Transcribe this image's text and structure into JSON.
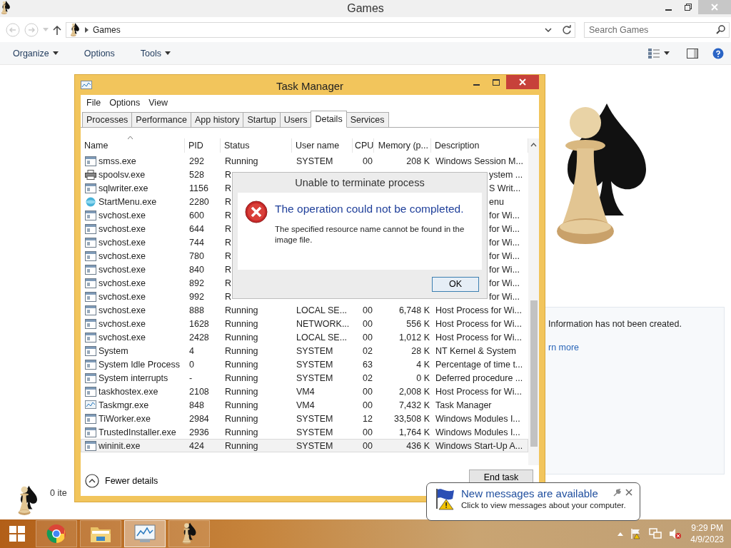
{
  "explorer": {
    "title": "Games",
    "breadcrumb": "Games",
    "search": {
      "placeholder": "Search Games"
    },
    "toolbar": [
      {
        "label": "Organize",
        "dropdown": true
      },
      {
        "label": "Options",
        "dropdown": false
      },
      {
        "label": "Tools",
        "dropdown": true
      }
    ],
    "info": {
      "text": "Information has not been created.",
      "link": "rn more"
    },
    "status": "0 ite"
  },
  "task_manager": {
    "title": "Task Manager",
    "menu": [
      "File",
      "Options",
      "View"
    ],
    "tabs": [
      {
        "label": "Processes",
        "selected": false
      },
      {
        "label": "Performance",
        "selected": false
      },
      {
        "label": "App history",
        "selected": false
      },
      {
        "label": "Startup",
        "selected": false
      },
      {
        "label": "Users",
        "selected": false
      },
      {
        "label": "Details",
        "selected": true
      },
      {
        "label": "Services",
        "selected": false
      }
    ],
    "columns": [
      "Name",
      "PID",
      "Status",
      "User name",
      "CPU",
      "Memory (p...",
      "Description"
    ],
    "rows": [
      {
        "kind": "window",
        "name": "smss.exe",
        "pid": "292",
        "status": "Running",
        "user": "SYSTEM",
        "cpu": "00",
        "memory": "208 K",
        "description": "Windows Session M...",
        "selected": false
      },
      {
        "kind": "printer",
        "name": "spoolsv.exe",
        "pid": "528",
        "status": "R",
        "description": "ystem ...",
        "selected": false
      },
      {
        "kind": "window",
        "name": "sqlwriter.exe",
        "pid": "1156",
        "status": "R",
        "description": "S Writ...",
        "selected": false
      },
      {
        "kind": "globe",
        "name": "StartMenu.exe",
        "pid": "2280",
        "status": "R",
        "description": "enu",
        "selected": false
      },
      {
        "kind": "window",
        "name": "svchost.exe",
        "pid": "600",
        "status": "R",
        "description": "for Wi...",
        "selected": false
      },
      {
        "kind": "window",
        "name": "svchost.exe",
        "pid": "644",
        "status": "R",
        "description": "for Wi...",
        "selected": false
      },
      {
        "kind": "window",
        "name": "svchost.exe",
        "pid": "744",
        "status": "R",
        "description": "for Wi...",
        "selected": false
      },
      {
        "kind": "window",
        "name": "svchost.exe",
        "pid": "780",
        "status": "R",
        "description": "for Wi...",
        "selected": false
      },
      {
        "kind": "window",
        "name": "svchost.exe",
        "pid": "840",
        "status": "R",
        "description": "for Wi...",
        "selected": false
      },
      {
        "kind": "window",
        "name": "svchost.exe",
        "pid": "892",
        "status": "R",
        "description": "for Wi...",
        "selected": false
      },
      {
        "kind": "window",
        "name": "svchost.exe",
        "pid": "992",
        "status": "R",
        "description": "for Wi...",
        "selected": false
      },
      {
        "kind": "window",
        "name": "svchost.exe",
        "pid": "888",
        "status": "Running",
        "user": "LOCAL SE...",
        "cpu": "00",
        "memory": "6,748 K",
        "description": "Host Process for Wi...",
        "selected": false
      },
      {
        "kind": "window",
        "name": "svchost.exe",
        "pid": "1628",
        "status": "Running",
        "user": "NETWORK...",
        "cpu": "00",
        "memory": "556 K",
        "description": "Host Process for Wi...",
        "selected": false
      },
      {
        "kind": "window",
        "name": "svchost.exe",
        "pid": "2428",
        "status": "Running",
        "user": "LOCAL SE...",
        "cpu": "00",
        "memory": "1,012 K",
        "description": "Host Process for Wi...",
        "selected": false
      },
      {
        "kind": "window",
        "name": "System",
        "pid": "4",
        "status": "Running",
        "user": "SYSTEM",
        "cpu": "02",
        "memory": "28 K",
        "description": "NT Kernel & System",
        "selected": false
      },
      {
        "kind": "window",
        "name": "System Idle Process",
        "pid": "0",
        "status": "Running",
        "user": "SYSTEM",
        "cpu": "63",
        "memory": "4 K",
        "description": "Percentage of time t...",
        "selected": false
      },
      {
        "kind": "window",
        "name": "System interrupts",
        "pid": "-",
        "status": "Running",
        "user": "SYSTEM",
        "cpu": "02",
        "memory": "0 K",
        "description": "Deferred procedure ...",
        "selected": false
      },
      {
        "kind": "window",
        "name": "taskhostex.exe",
        "pid": "2108",
        "status": "Running",
        "user": "VM4",
        "cpu": "00",
        "memory": "2,008 K",
        "description": "Host Process for Wi...",
        "selected": false
      },
      {
        "kind": "chart",
        "name": "Taskmgr.exe",
        "pid": "848",
        "status": "Running",
        "user": "VM4",
        "cpu": "00",
        "memory": "7,432 K",
        "description": "Task Manager",
        "selected": false
      },
      {
        "kind": "window",
        "name": "TiWorker.exe",
        "pid": "2984",
        "status": "Running",
        "user": "SYSTEM",
        "cpu": "12",
        "memory": "33,508 K",
        "description": "Windows Modules I...",
        "selected": false
      },
      {
        "kind": "window",
        "name": "TrustedInstaller.exe",
        "pid": "2936",
        "status": "Running",
        "user": "SYSTEM",
        "cpu": "00",
        "memory": "1,764 K",
        "description": "Windows Modules I...",
        "selected": false
      },
      {
        "kind": "window",
        "name": "wininit.exe",
        "pid": "424",
        "status": "Running",
        "user": "SYSTEM",
        "cpu": "00",
        "memory": "436 K",
        "description": "Windows Start-Up A...",
        "selected": true
      }
    ],
    "footer": {
      "toggle": "Fewer details",
      "button": "End task"
    }
  },
  "dialog": {
    "title": "Unable to terminate process",
    "heading": "The operation could not be completed.",
    "message": "The specified resource name cannot be found in the image file.",
    "button": "OK"
  },
  "notification": {
    "title": "New messages are available",
    "message": "Click to view messages about your computer."
  },
  "taskbar": {
    "apps": [
      {
        "kind": "chrome",
        "selected": false
      },
      {
        "kind": "explorer",
        "selected": false
      },
      {
        "kind": "taskmgr",
        "selected": true
      },
      {
        "kind": "games",
        "selected": false
      }
    ],
    "clock": {
      "time": "9:29 PM",
      "date": "4/9/2023"
    }
  }
}
